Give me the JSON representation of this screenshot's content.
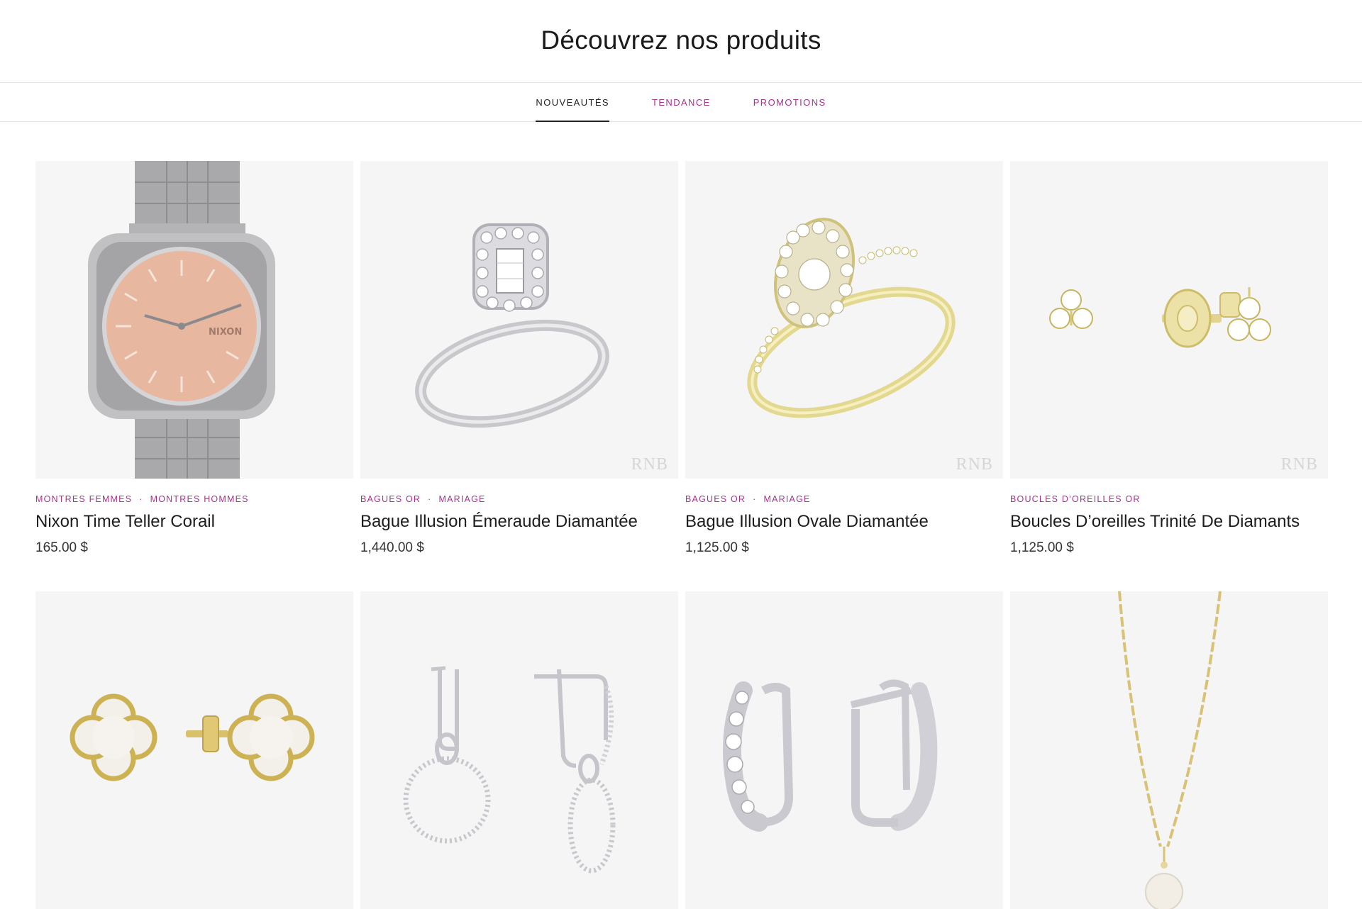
{
  "header": {
    "title": "Découvrez nos produits"
  },
  "tabs": [
    {
      "label": "NOUVEAUTÉS",
      "active": true
    },
    {
      "label": "TENDANCE",
      "active": false
    },
    {
      "label": "PROMOTIONS",
      "active": false
    }
  ],
  "accent_color": "#a8328f",
  "products": [
    {
      "categories": [
        "MONTRES FEMMES",
        "MONTRES HOMMES"
      ],
      "name": "Nixon Time Teller Corail",
      "price": "165.00 $",
      "image": "watch-icon",
      "watch_brand": "NIXON"
    },
    {
      "categories": [
        "BAGUES OR",
        "MARIAGE"
      ],
      "name": "Bague Illusion Émeraude Diamantée",
      "price": "1,440.00 $",
      "image": "ring-icon",
      "watermark": "RNB"
    },
    {
      "categories": [
        "BAGUES OR",
        "MARIAGE"
      ],
      "name": "Bague Illusion Ovale Diamantée",
      "price": "1,125.00 $",
      "image": "ring-icon",
      "watermark": "RNB"
    },
    {
      "categories": [
        "BOUCLES D’OREILLES OR"
      ],
      "name": "Boucles D’oreilles Trinité De Diamants",
      "price": "1,125.00 $",
      "image": "earrings-icon",
      "watermark": "RNB"
    },
    {
      "image": "clover-earrings-icon"
    },
    {
      "image": "hoop-earrings-icon"
    },
    {
      "image": "huggie-earrings-icon"
    },
    {
      "image": "pearl-necklace-icon"
    }
  ]
}
